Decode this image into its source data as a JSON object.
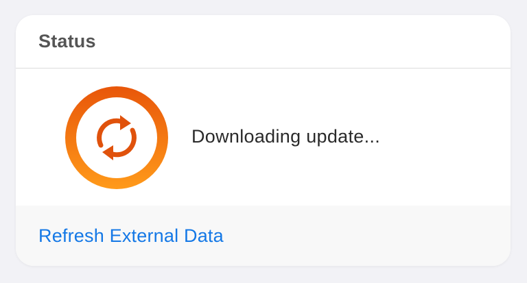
{
  "card": {
    "title": "Status"
  },
  "status": {
    "message": "Downloading update...",
    "icon": "sync-arrows-icon",
    "ring_colors": [
      "#e8560a",
      "#ff9a1a"
    ],
    "arrow_color": "#e0520c"
  },
  "footer": {
    "action_label": "Refresh External Data",
    "action_color": "#1478e6"
  }
}
